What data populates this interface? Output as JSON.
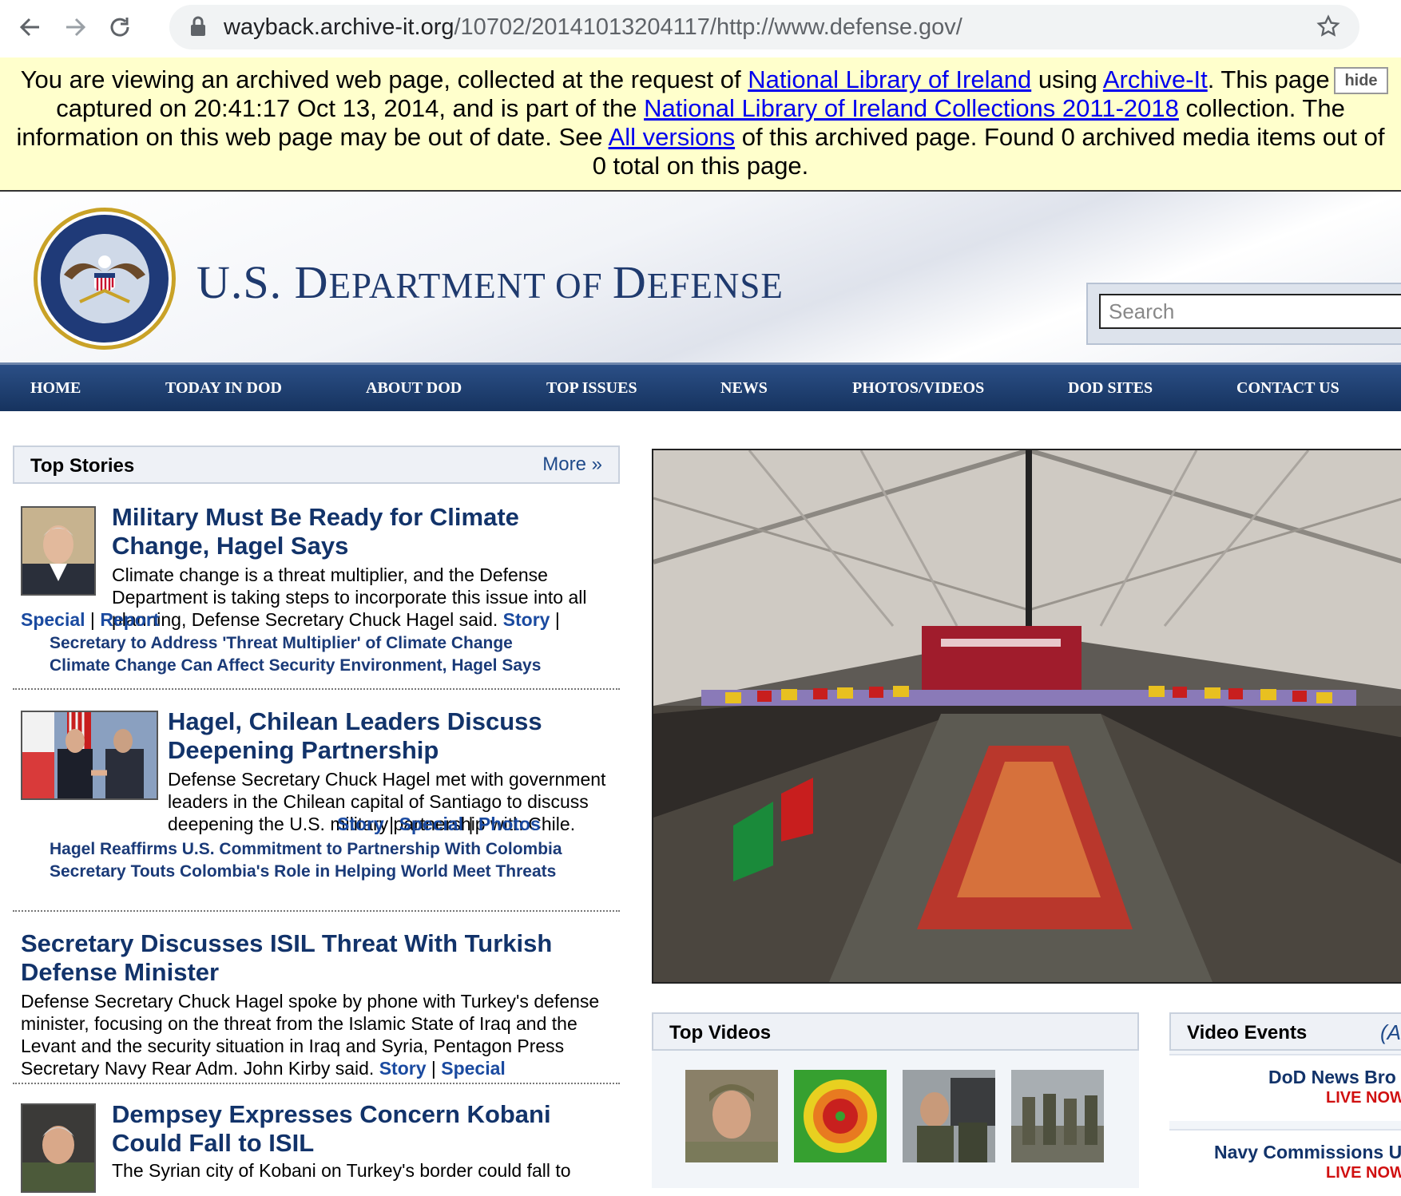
{
  "browser": {
    "url_host": "wayback.archive-it.org",
    "url_path": "/10702/20141013204117/http://www.defense.gov/"
  },
  "banner": {
    "t1": "You are viewing an archived web page, collected at the request of ",
    "link1": "National Library of Ireland",
    "t2": " using ",
    "link2": "Archive-It",
    "t3": ". This page was captured on 20:41:17 Oct 13, 2014, and is part of the ",
    "link3": "National Library of Ireland Collections 2011-2018",
    "t4": " collection. The information on this web page may be out of date. See ",
    "link4": "All versions",
    "t5": " of this archived page. Found 0 archived media items out of 0 total on this page.",
    "hide": "hide"
  },
  "header": {
    "title_u": "U.S. D",
    "title_a": "EPARTMENT OF ",
    "title_d": "D",
    "title_e": "EFENSE",
    "search_placeholder": "Search"
  },
  "nav": [
    "HOME",
    "TODAY IN DOD",
    "ABOUT DOD",
    "TOP ISSUES",
    "NEWS",
    "PHOTOS/VIDEOS",
    "DOD SITES",
    "CONTACT US"
  ],
  "top_stories": {
    "title": "Top Stories",
    "more": "More »",
    "stories": [
      {
        "headline": "Military Must Be Ready for Climate Change, Hagel Says",
        "summary": "Climate change is a threat multiplier, and the Defense Department is taking steps to incorporate this issue into all planning, Defense Secretary Chuck Hagel said.",
        "links": [
          "Story",
          "Special",
          "Report"
        ],
        "related": [
          "Secretary to Address 'Threat Multiplier' of Climate Change",
          "Climate Change Can Affect Security Environment, Hagel Says"
        ]
      },
      {
        "headline": "Hagel, Chilean Leaders Discuss Deepening Partnership",
        "summary": "Defense Secretary Chuck Hagel met with government leaders in the Chilean capital of Santiago to discuss deepening the U.S. military partnership with Chile.",
        "links": [
          "Story",
          "Special",
          "Photos"
        ],
        "related": [
          "Hagel Reaffirms U.S. Commitment to Partnership With Colombia",
          "Secretary Touts Colombia's Role in Helping World Meet Threats"
        ]
      },
      {
        "headline": "Secretary Discusses ISIL Threat With Turkish Defense Minister",
        "summary": "Defense Secretary Chuck Hagel spoke by phone with Turkey's defense minister, focusing on the threat from the Islamic State of Iraq and the Levant and the security situation in Iraq and Syria, Pentagon Press Secretary Navy Rear Adm. John Kirby said.",
        "links": [
          "Story",
          "Special"
        ]
      },
      {
        "headline": "Dempsey Expresses Concern Kobani Could Fall to ISIL",
        "summary": "The Syrian city of Kobani on Turkey's border could fall to"
      }
    ]
  },
  "top_videos": {
    "title": "Top Videos"
  },
  "video_events": {
    "title": "Video Events",
    "extra": "(A",
    "items": [
      {
        "name": "DoD News Bro",
        "status": "LIVE NOW"
      },
      {
        "name": "Navy Commissions U",
        "status": "LIVE NOW"
      }
    ]
  }
}
